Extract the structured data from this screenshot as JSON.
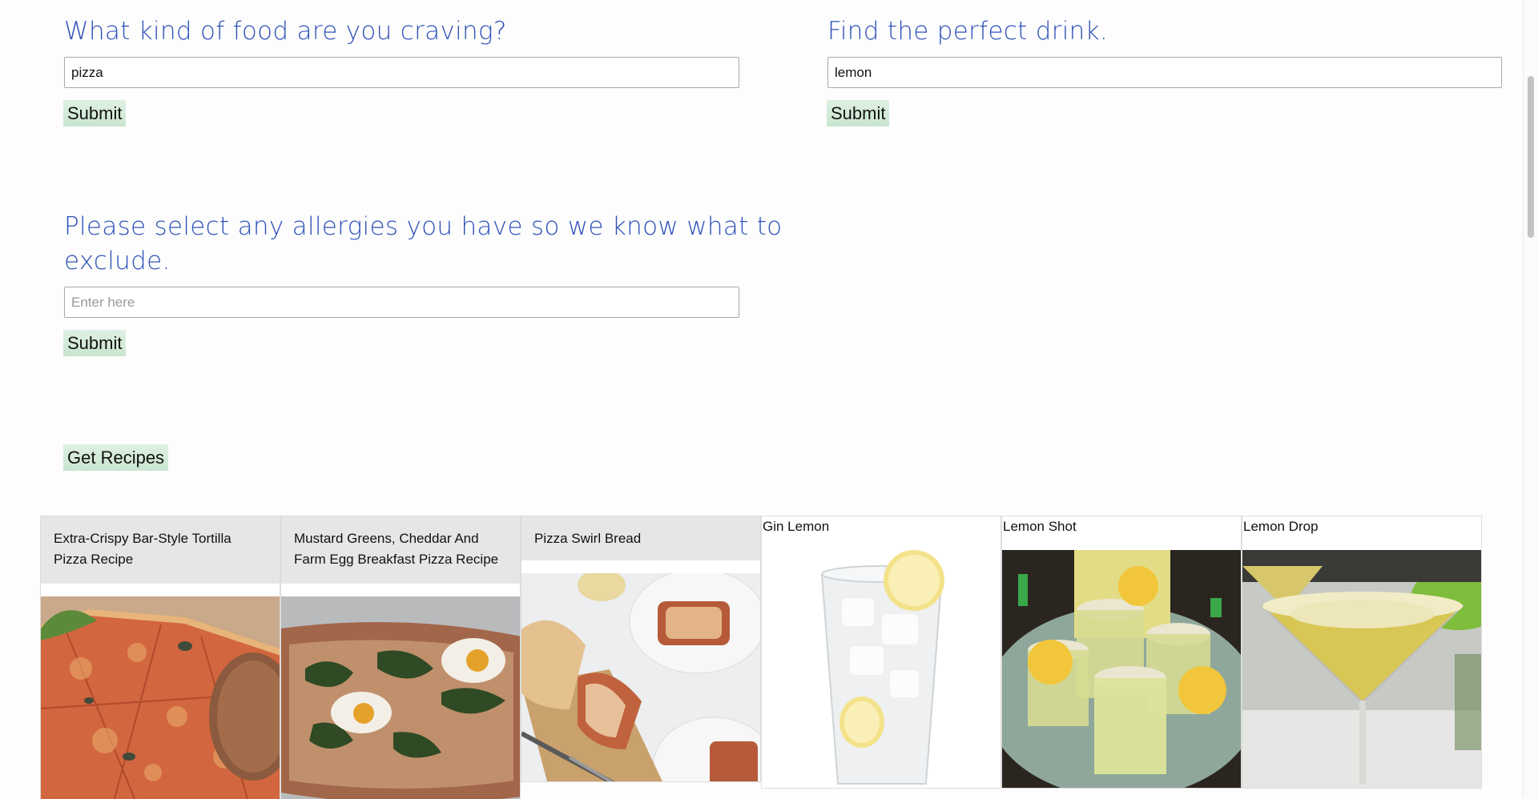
{
  "food": {
    "heading": "What kind of food are you craving?",
    "value": "pizza",
    "submit_label": "Submit"
  },
  "drink": {
    "heading": "Find the perfect drink.",
    "value": "lemon",
    "submit_label": "Submit"
  },
  "allergies": {
    "heading_line1": "Please select any allergies you have so we know what to",
    "heading_line2": "exclude.",
    "placeholder": "Enter here",
    "submit_label": "Submit"
  },
  "get_recipes_label": "Get Recipes",
  "recipes": [
    {
      "title": "Extra-Crispy Bar-Style Tortilla Pizza Recipe",
      "image": "pizza-slices-photo"
    },
    {
      "title": "Mustard Greens, Cheddar And Farm Egg Breakfast Pizza Recipe",
      "image": "greens-egg-pizza-photo"
    },
    {
      "title": "Pizza Swirl Bread",
      "image": "swirl-bread-photo"
    }
  ],
  "drinks": [
    {
      "title": "Gin Lemon",
      "image": "highball-lemon-photo"
    },
    {
      "title": "Lemon Shot",
      "image": "lemon-shots-photo"
    },
    {
      "title": "Lemon Drop",
      "image": "martini-glass-photo"
    }
  ],
  "colors": {
    "heading": "#2f52b8",
    "button": "#cfe8d5",
    "card_title_bg": "#e6e6e6"
  }
}
